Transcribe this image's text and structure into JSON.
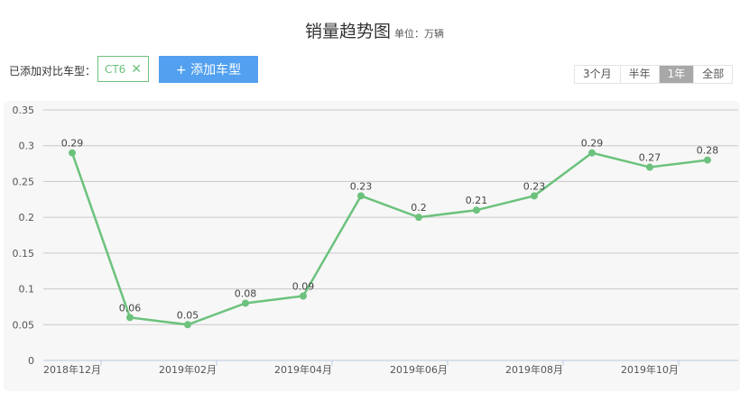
{
  "header": {
    "title": "销量趋势图",
    "unit": "单位：万辆"
  },
  "compare": {
    "label": "已添加对比车型：",
    "tag": "CT6",
    "add_button": "+ 添加车型"
  },
  "range_tabs": [
    {
      "label": "3个月",
      "active": false
    },
    {
      "label": "半年",
      "active": false
    },
    {
      "label": "1年",
      "active": true
    },
    {
      "label": "全部",
      "active": false
    }
  ],
  "chart_data": {
    "type": "line",
    "title": "销量趋势图",
    "ylabel": "万辆",
    "ylim": [
      0,
      0.35
    ],
    "yticks": [
      "0",
      "0.05",
      "0.1",
      "0.15",
      "0.2",
      "0.25",
      "0.3",
      "0.35"
    ],
    "xtick_labels": [
      "2018年12月",
      "2019年02月",
      "2019年04月",
      "2019年06月",
      "2019年08月",
      "2019年10月"
    ],
    "categories": [
      "2018-12",
      "2019-01",
      "2019-02",
      "2019-03",
      "2019-04",
      "2019-05",
      "2019-06",
      "2019-07",
      "2019-08",
      "2019-09",
      "2019-10",
      "2019-11"
    ],
    "series": [
      {
        "name": "CT6",
        "color": "#6cc27d",
        "values": [
          0.29,
          0.06,
          0.05,
          0.08,
          0.09,
          0.23,
          0.2,
          0.21,
          0.23,
          0.29,
          0.27,
          0.28
        ]
      }
    ],
    "grid": true
  }
}
